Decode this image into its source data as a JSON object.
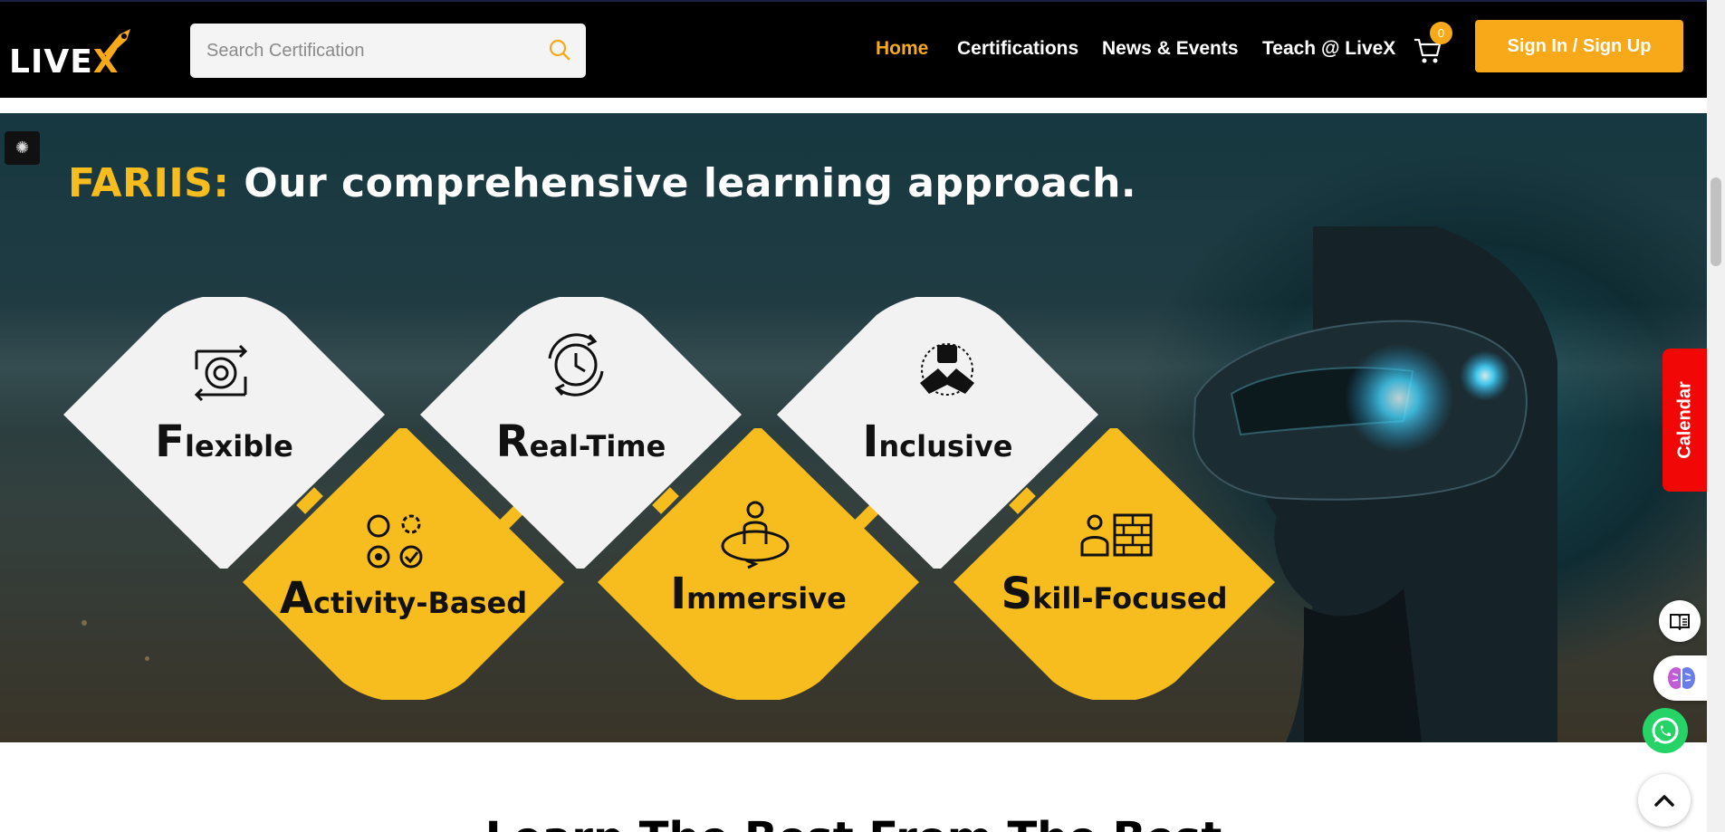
{
  "header": {
    "logo_text": "LIVE",
    "logo_accent": "X",
    "search": {
      "placeholder": "Search Certification"
    },
    "nav": [
      {
        "label": "Home",
        "active": true
      },
      {
        "label": "Certifications",
        "active": false
      },
      {
        "label": "News & Events",
        "active": false
      },
      {
        "label": "Teach @ LiveX",
        "active": false
      }
    ],
    "cart_count": "0",
    "signin_label": "Sign In / Sign Up"
  },
  "hero": {
    "title_highlight": "FARIIS:",
    "title_rest": " Our comprehensive learning approach.",
    "pillars": [
      {
        "cap": "F",
        "rest": "lexible",
        "icon": "flexible-gear-icon",
        "color": "white"
      },
      {
        "cap": "R",
        "rest": "eal-Time",
        "icon": "clock-icon",
        "color": "white"
      },
      {
        "cap": "I",
        "rest": "nclusive",
        "icon": "hands-together-icon",
        "color": "white"
      },
      {
        "cap": "A",
        "rest": "ctivity-Based",
        "icon": "activity-icons",
        "color": "yellow"
      },
      {
        "cap": "I",
        "rest": "mmersive",
        "icon": "person-circle-icon",
        "color": "yellow"
      },
      {
        "cap": "S",
        "rest": "kill-Focused",
        "icon": "worker-bricks-icon",
        "color": "yellow"
      }
    ]
  },
  "floating": {
    "calendar_label": "Calendar"
  },
  "section": {
    "heading": "Learn The Best From The Best"
  },
  "colors": {
    "accent": "#f7a91a",
    "diamond_yellow": "#f7bd1e",
    "diamond_white": "#f2f2f2",
    "calendar_red": "#f20707",
    "whatsapp_green": "#25d366"
  }
}
